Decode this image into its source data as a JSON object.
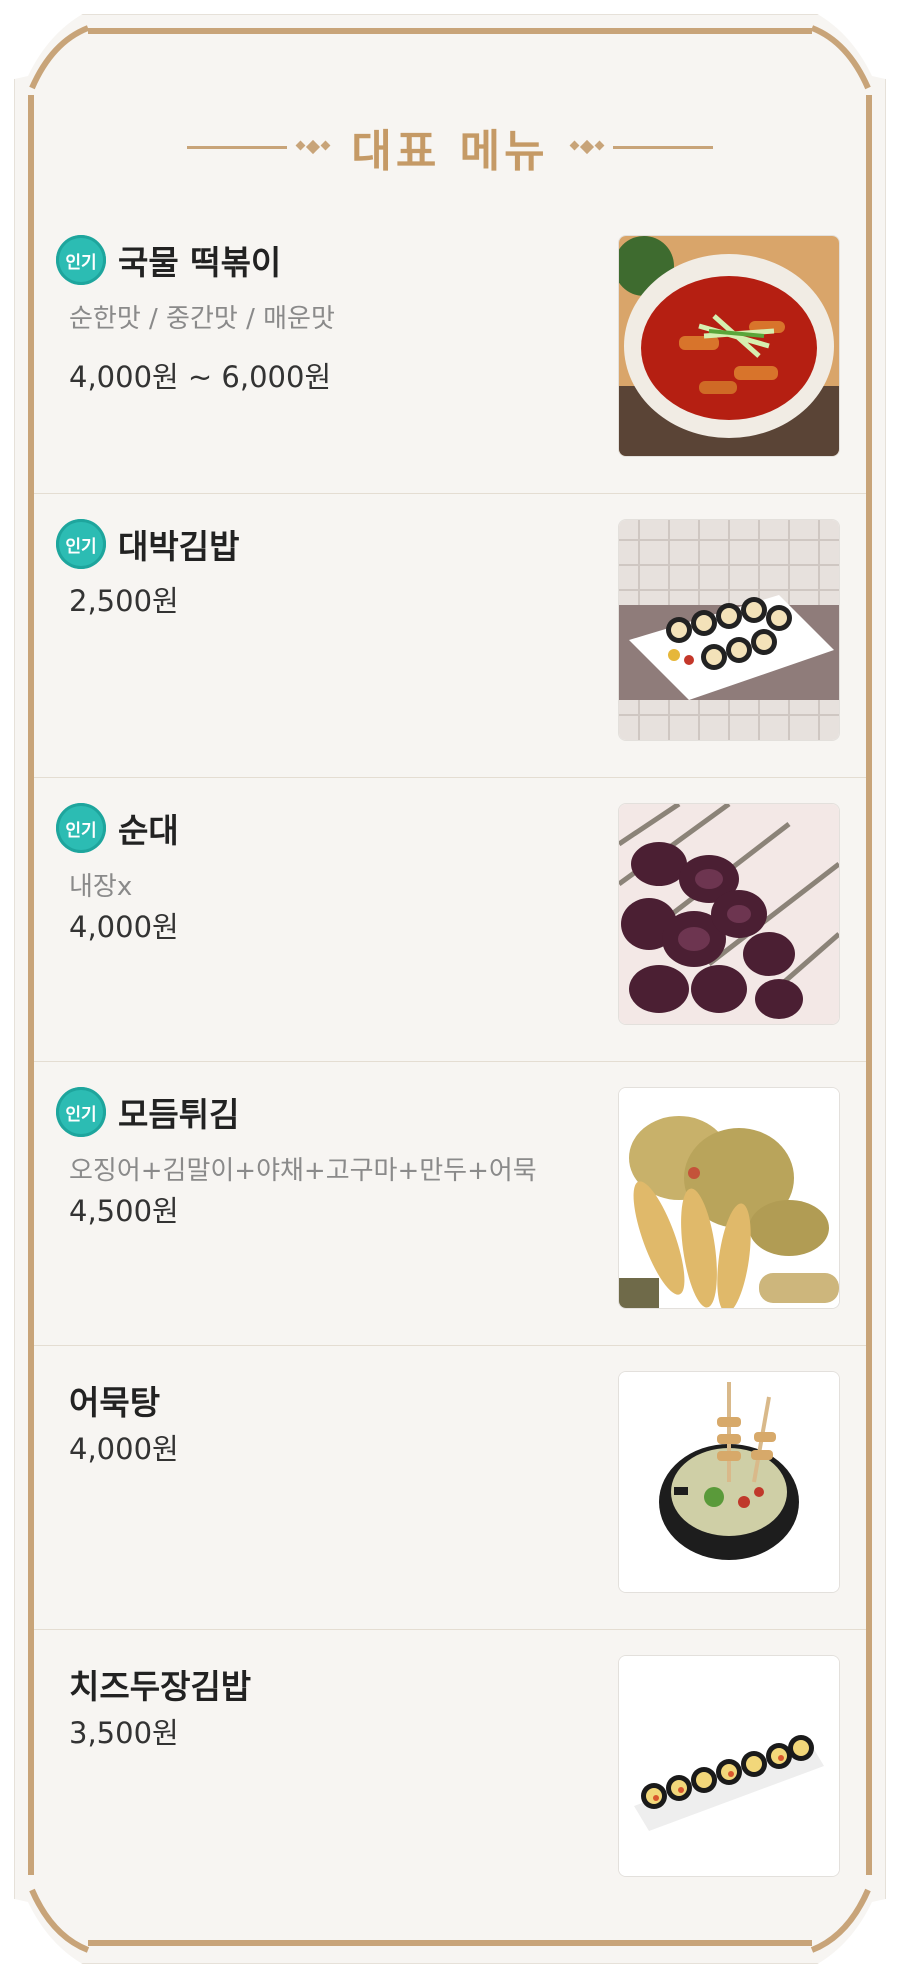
{
  "header": {
    "title": "대표 메뉴"
  },
  "menu": [
    {
      "name": "국물 떡볶이",
      "badge": "인기",
      "description": "순한맛 / 중간맛 / 매운맛",
      "price": "4,000원 ~ 6,000원",
      "image": "tteokbokki-photo"
    },
    {
      "name": "대박김밥",
      "badge": "인기",
      "description": "",
      "price": "2,500원",
      "image": "gimbap-plate-photo"
    },
    {
      "name": "순대",
      "badge": "인기",
      "description": "내장x",
      "price": "4,000원",
      "image": "sundae-photo"
    },
    {
      "name": "모듬튀김",
      "badge": "인기",
      "description": "오징어+김말이+야채+고구마+만두+어묵",
      "price": "4,500원",
      "image": "fried-assortment-photo"
    },
    {
      "name": "어묵탕",
      "badge": "",
      "description": "",
      "price": "4,000원",
      "image": "fishcake-soup-photo"
    },
    {
      "name": "치즈두장김밥",
      "badge": "",
      "description": "",
      "price": "3,500원",
      "image": "cheese-gimbap-photo"
    }
  ],
  "colors": {
    "accent": "#c8a479",
    "title": "#c59a66",
    "badge": "#2cbcb3",
    "background": "#f7f5f2"
  }
}
